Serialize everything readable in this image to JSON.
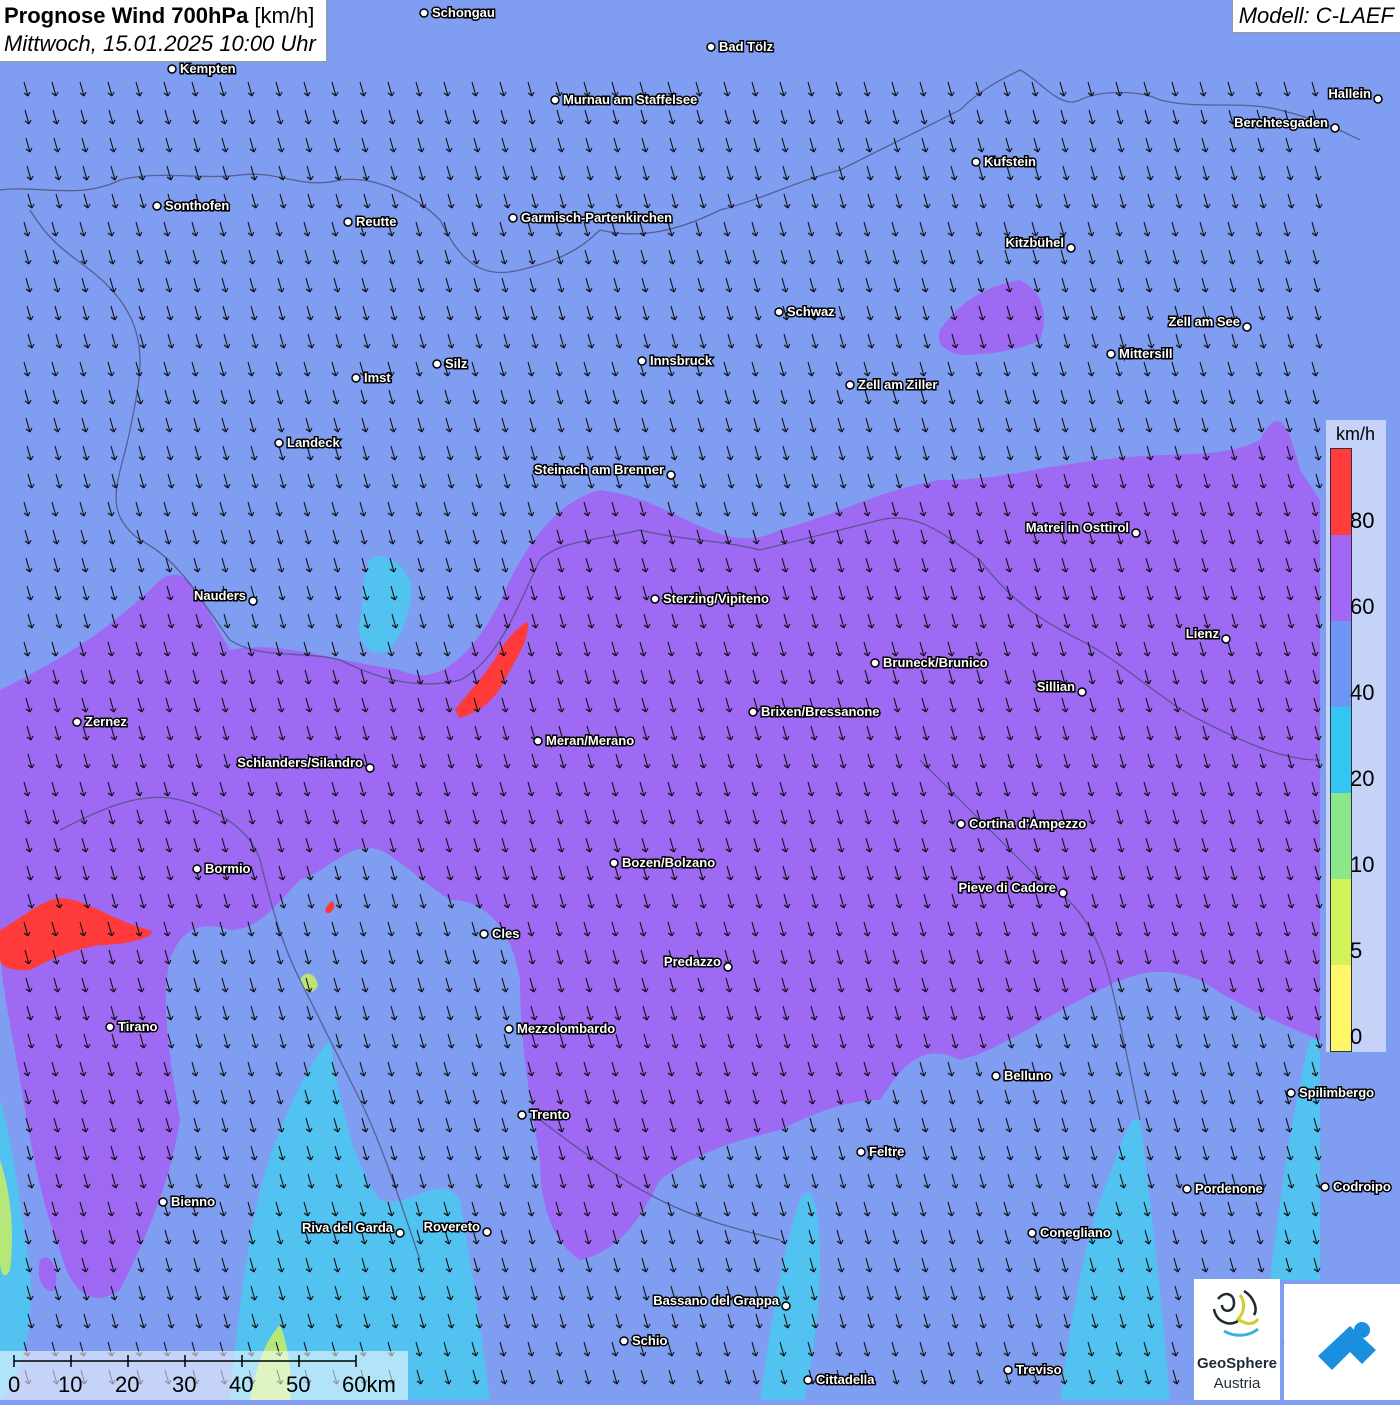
{
  "title": {
    "line1_bold": "Prognose Wind 700hPa",
    "line1_unit": " [km/h]",
    "line2": "Mittwoch, 15.01.2025 10:00 Uhr"
  },
  "model": "Modell: C-LAEF",
  "legend": {
    "unit": "km/h",
    "labels": [
      "80",
      "60",
      "40",
      "20",
      "10",
      "5",
      "0"
    ],
    "colors": [
      "#ff3d3d",
      "#a367f5",
      "#6e96f5",
      "#33c6f2",
      "#8be88a",
      "#d4f25a",
      "#fff66a"
    ]
  },
  "scale": {
    "labels": [
      "0",
      "10",
      "20",
      "30",
      "40",
      "50",
      "60km"
    ]
  },
  "logos": {
    "geosphere_line1": "GeoSphere",
    "geosphere_line2": "Austria"
  },
  "cities": [
    {
      "name": "Schongau"
    },
    {
      "name": "Kempten"
    },
    {
      "name": "Bad Tölz"
    },
    {
      "name": "Murnau am Staffelsee"
    },
    {
      "name": "Hallein"
    },
    {
      "name": "Berchtesgaden"
    },
    {
      "name": "Kufstein"
    },
    {
      "name": "Sonthofen"
    },
    {
      "name": "Reutte"
    },
    {
      "name": "Garmisch-Partenkirchen"
    },
    {
      "name": "Kitzbühel"
    },
    {
      "name": "Schwaz"
    },
    {
      "name": "Zell am See"
    },
    {
      "name": "Innsbruck"
    },
    {
      "name": "Mittersill"
    },
    {
      "name": "Silz"
    },
    {
      "name": "Imst"
    },
    {
      "name": "Zell am Ziller"
    },
    {
      "name": "Landeck"
    },
    {
      "name": "Steinach am Brenner"
    },
    {
      "name": "Matrei in Osttirol"
    },
    {
      "name": "Nauders"
    },
    {
      "name": "Sterzing/Vipiteno"
    },
    {
      "name": "Lienz"
    },
    {
      "name": "Bruneck/Brunico"
    },
    {
      "name": "Sillian"
    },
    {
      "name": "Brixen/Bressanone"
    },
    {
      "name": "Zernez"
    },
    {
      "name": "Meran/Merano"
    },
    {
      "name": "Schlanders/Silandro"
    },
    {
      "name": "Cortina d'Ampezzo"
    },
    {
      "name": "Bozen/Bolzano"
    },
    {
      "name": "Bormio"
    },
    {
      "name": "Pieve di Cadore"
    },
    {
      "name": "Cles"
    },
    {
      "name": "Predazzo"
    },
    {
      "name": "Tirano"
    },
    {
      "name": "Mezzolombardo"
    },
    {
      "name": "Belluno"
    },
    {
      "name": "Spilimbergo"
    },
    {
      "name": "Trento"
    },
    {
      "name": "Feltre"
    },
    {
      "name": "Pordenone"
    },
    {
      "name": "Codroipo"
    },
    {
      "name": "Bienno"
    },
    {
      "name": "Riva del Garda"
    },
    {
      "name": "Rovereto"
    },
    {
      "name": "Conegliano"
    },
    {
      "name": "Bassano del Grappa"
    },
    {
      "name": "Schio"
    },
    {
      "name": "Treviso"
    },
    {
      "name": "Cittadella"
    }
  ]
}
